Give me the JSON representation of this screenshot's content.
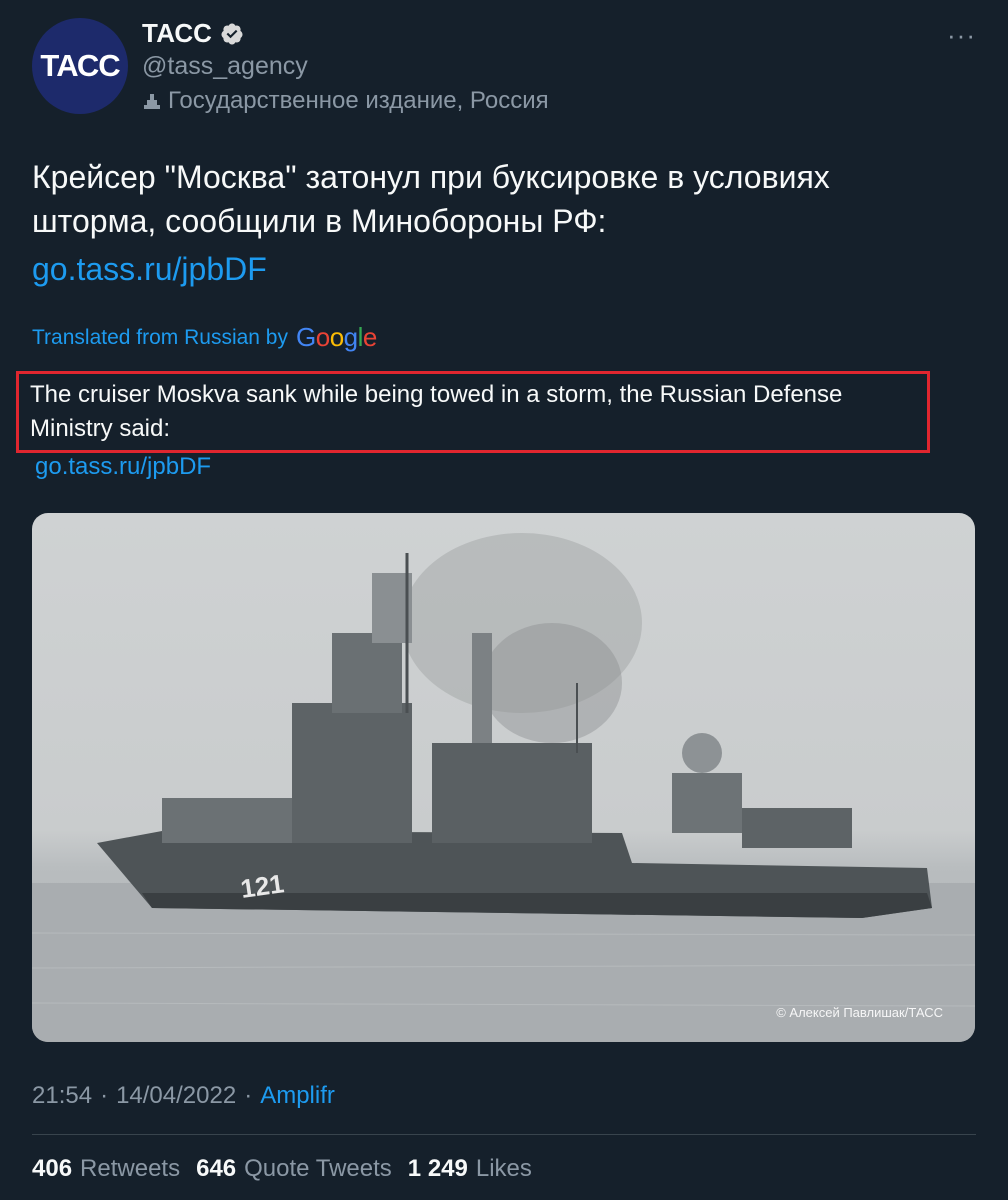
{
  "author": {
    "display_name": "ТАСС",
    "handle": "@tass_agency",
    "avatar_text": "ТАСС",
    "label": "Государственное издание, Россия",
    "verified_icon": "verified-badge-icon"
  },
  "tweet": {
    "text": "Крейсер \"Москва\" затонул при буксировке в условиях шторма, сообщили в Минобороны РФ:",
    "link": "go.tass.ru/jpbDF"
  },
  "translation": {
    "label": "Translated from Russian by",
    "provider": "Google",
    "text": "The cruiser Moskva sank while being towed in a storm, the Russian Defense Ministry said:",
    "link": "go.tass.ru/jpbDF"
  },
  "photo": {
    "credit": "© Алексей Павлишак/ТАСС",
    "hull_number": "121"
  },
  "meta": {
    "time": "21:54",
    "date": "14/04/2022",
    "separator": "·",
    "source": "Amplifr"
  },
  "stats": {
    "retweets_count": "406",
    "retweets_label": "Retweets",
    "quotes_count": "646",
    "quotes_label": "Quote Tweets",
    "likes_count": "1 249",
    "likes_label": "Likes"
  },
  "colors": {
    "background": "#15202b",
    "accent": "#1d9bf0",
    "highlight_border": "#e0262f"
  }
}
